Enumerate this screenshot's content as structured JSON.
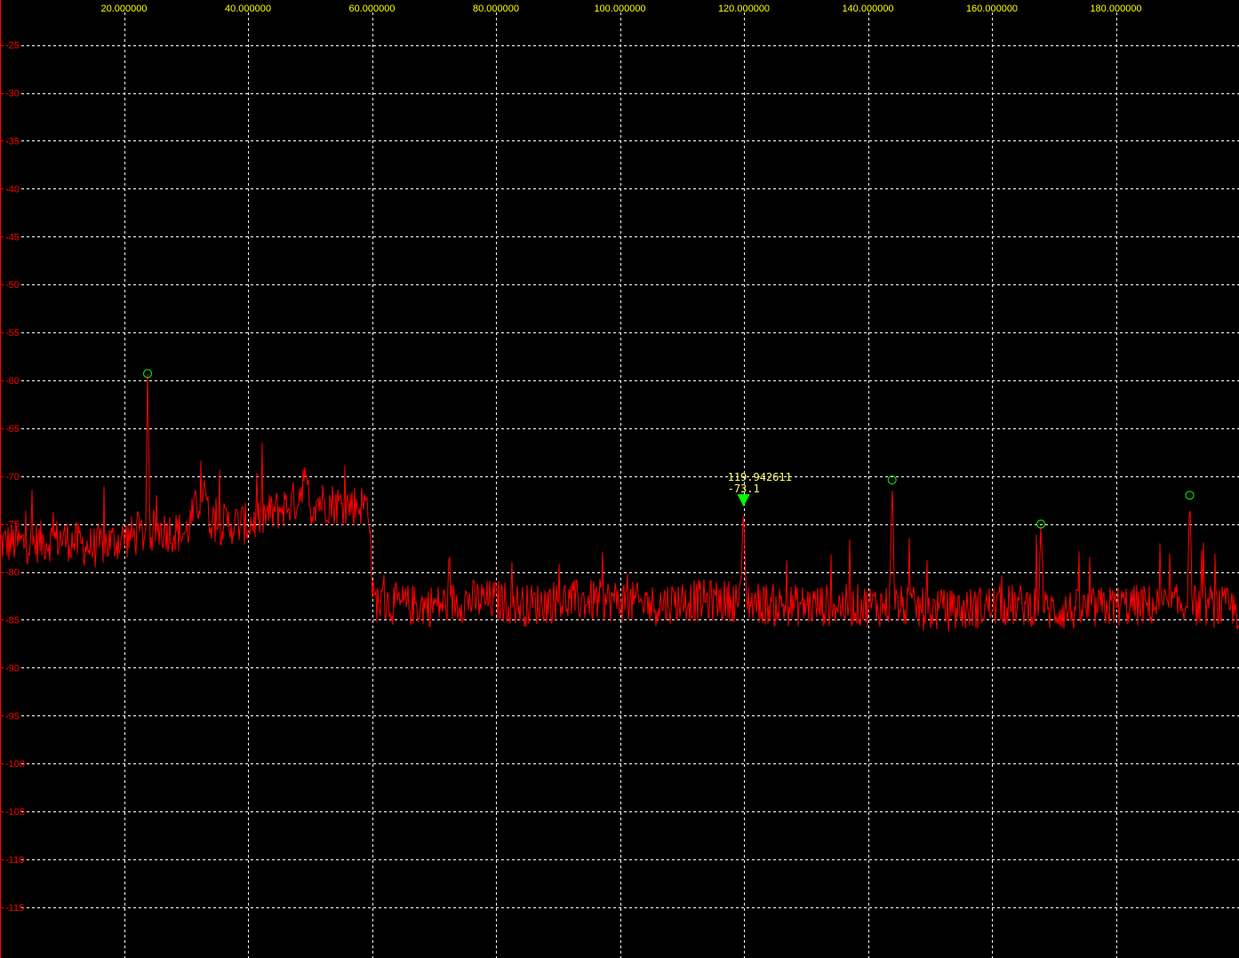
{
  "colors": {
    "background": "#000000",
    "grid": "#ffffff",
    "x_tick_text": "#ffff00",
    "y_tick_text": "#ff0000",
    "trace": "#ff0000",
    "marker": "#00ff00",
    "marker_text": "#ffff66",
    "peak_circle": "#00ff00"
  },
  "chart_data": {
    "type": "line",
    "title": "",
    "xlabel": "",
    "ylabel": "",
    "xlim": [
      0,
      200
    ],
    "ylim": [
      -120,
      -20.3
    ],
    "x_ticks": [
      20,
      40,
      60,
      80,
      100,
      120,
      140,
      160,
      180
    ],
    "x_tick_labels": [
      "20.000000",
      "40.000000",
      "60.000000",
      "80.000000",
      "100.000000",
      "120.000000",
      "140.000000",
      "160.000000",
      "180.000000"
    ],
    "y_ticks": [
      -25,
      -30,
      -35,
      -40,
      -45,
      -50,
      -55,
      -60,
      -65,
      -70,
      -75,
      -80,
      -85,
      -90,
      -95,
      -100,
      -105,
      -110,
      -115
    ],
    "y_tick_labels": [
      "-25",
      "-30",
      "-35",
      "-40",
      "-45",
      "-50",
      "-55",
      "-60",
      "-65",
      "-70",
      "-75",
      "-80",
      "-85",
      "-90",
      "-95",
      "-100",
      "-105",
      "-110",
      "-115"
    ],
    "grid": true,
    "series": [
      {
        "x": [
          0,
          5,
          10,
          15,
          20,
          23.5,
          23.8,
          24.2,
          25,
          30,
          32.5,
          33,
          33.5,
          35,
          40,
          45,
          48,
          49,
          50,
          51,
          55,
          59.5,
          60.2,
          65,
          70,
          75,
          80,
          85,
          90,
          95,
          100,
          105,
          110,
          115,
          119.5,
          119.9,
          120.4,
          125,
          130,
          135,
          140,
          143.5,
          143.9,
          144.4,
          150,
          155,
          160,
          167.5,
          167.9,
          168.4,
          175,
          180,
          185,
          191.5,
          191.9,
          192.4,
          195,
          200
        ],
        "y": [
          -77,
          -77,
          -76.5,
          -77.5,
          -76.5,
          -76,
          -59.3,
          -76,
          -75.5,
          -76,
          -72,
          -70,
          -74,
          -75,
          -75,
          -73.5,
          -72.5,
          -70,
          -73.5,
          -72.5,
          -73,
          -73,
          -83,
          -83.5,
          -83.5,
          -83,
          -83,
          -83.5,
          -83,
          -83,
          -83,
          -83.5,
          -83,
          -83,
          -83,
          -73.1,
          -83,
          -83.5,
          -83.5,
          -83.5,
          -83.5,
          -83.5,
          -70.4,
          -83.5,
          -84,
          -84,
          -83.5,
          -83.5,
          -75.0,
          -84,
          -84,
          -83.5,
          -83.5,
          -83.5,
          -72.0,
          -83.5,
          -83.5,
          -84
        ]
      }
    ],
    "peaks": [
      {
        "x": 23.8,
        "y": -59.3
      },
      {
        "x": 143.9,
        "y": -70.4
      },
      {
        "x": 167.9,
        "y": -75.0
      },
      {
        "x": 191.9,
        "y": -72.0
      }
    ],
    "marker": {
      "x": 119.942611,
      "y": -73.1,
      "freq_label": "119.942611",
      "level_label": "-73.1"
    }
  }
}
